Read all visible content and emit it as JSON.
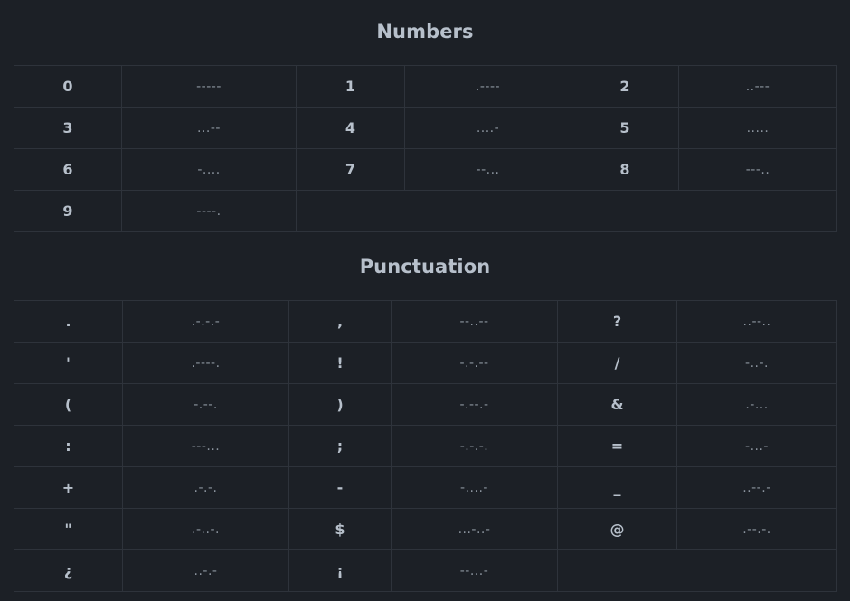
{
  "numbers": {
    "title": "Numbers",
    "rows": [
      [
        [
          "0",
          "-----"
        ],
        [
          "1",
          ".----"
        ],
        [
          "2",
          "..---"
        ]
      ],
      [
        [
          "3",
          "...--"
        ],
        [
          "4",
          "....-"
        ],
        [
          "5",
          "....."
        ]
      ],
      [
        [
          "6",
          "-...."
        ],
        [
          "7",
          "--..."
        ],
        [
          "8",
          "---.."
        ]
      ],
      [
        [
          "9",
          "----."
        ]
      ]
    ]
  },
  "punctuation": {
    "title": "Punctuation",
    "rows": [
      [
        [
          ".",
          ".-.-.-"
        ],
        [
          ",",
          "--..--"
        ],
        [
          "?",
          "..--.."
        ]
      ],
      [
        [
          "'",
          ".----."
        ],
        [
          "!",
          "-.-.--"
        ],
        [
          "/",
          "-..-."
        ]
      ],
      [
        [
          "(",
          "-.--."
        ],
        [
          ")",
          "-.--.-"
        ],
        [
          "&",
          ".-..."
        ]
      ],
      [
        [
          ":",
          "---..."
        ],
        [
          ";",
          "-.-.-."
        ],
        [
          "=",
          "-...-"
        ]
      ],
      [
        [
          "+",
          ".-.-."
        ],
        [
          "-",
          "-....-"
        ],
        [
          "_",
          "..--.-"
        ]
      ],
      [
        [
          "\"",
          ".-..-."
        ],
        [
          "$",
          "...-..-"
        ],
        [
          "@",
          ".--.-."
        ]
      ],
      [
        [
          "¿",
          "..-.-"
        ],
        [
          "¡",
          "--...-"
        ]
      ]
    ]
  }
}
